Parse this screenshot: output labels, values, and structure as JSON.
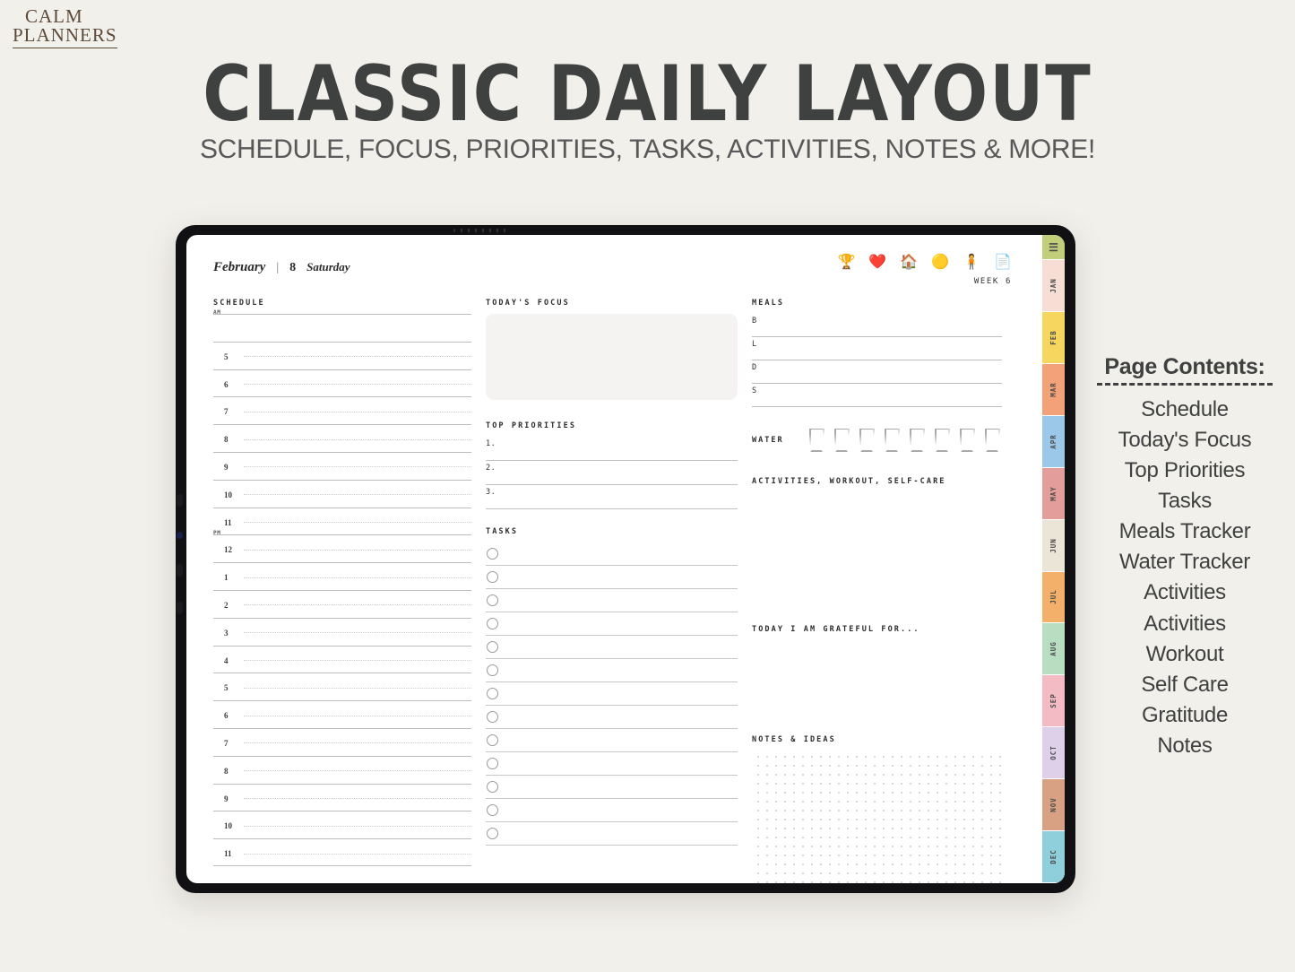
{
  "brand": {
    "line1": "CALM",
    "line2": "PLANNERS"
  },
  "header": {
    "title": "CLASSIC DAILY LAYOUT",
    "subtitle": "SCHEDULE, FOCUS, PRIORITIES, TASKS, ACTIVITIES, NOTES & MORE!"
  },
  "planner": {
    "date": {
      "month": "February",
      "separator": "|",
      "day": "8",
      "weekday": "Saturday"
    },
    "week": "WEEK 6",
    "top_icons": [
      {
        "name": "trophy-icon",
        "glyph": "🏆"
      },
      {
        "name": "heart-icon",
        "glyph": "❤️"
      },
      {
        "name": "house-icon",
        "glyph": "🏠"
      },
      {
        "name": "sun-circle-icon",
        "glyph": "🟡"
      },
      {
        "name": "person-icon",
        "glyph": "🧍"
      },
      {
        "name": "document-icon",
        "glyph": "📄"
      }
    ],
    "schedule": {
      "title": "SCHEDULE",
      "am_label": "AM",
      "pm_label": "PM",
      "rows": [
        {
          "hour": "",
          "marker": "AM"
        },
        {
          "hour": "5"
        },
        {
          "hour": "6"
        },
        {
          "hour": "7"
        },
        {
          "hour": "8"
        },
        {
          "hour": "9"
        },
        {
          "hour": "10"
        },
        {
          "hour": "11"
        },
        {
          "hour": "12",
          "marker": "PM"
        },
        {
          "hour": "1"
        },
        {
          "hour": "2"
        },
        {
          "hour": "3"
        },
        {
          "hour": "4"
        },
        {
          "hour": "5"
        },
        {
          "hour": "6"
        },
        {
          "hour": "7"
        },
        {
          "hour": "8"
        },
        {
          "hour": "9"
        },
        {
          "hour": "10"
        },
        {
          "hour": "11"
        }
      ]
    },
    "focus": {
      "title": "TODAY'S FOCUS",
      "value": ""
    },
    "priorities": {
      "title": "TOP PRIORITIES",
      "items": [
        {
          "label": "1.",
          "value": ""
        },
        {
          "label": "2.",
          "value": ""
        },
        {
          "label": "3.",
          "value": ""
        }
      ]
    },
    "tasks": {
      "title": "TASKS",
      "items": [
        "",
        "",
        "",
        "",
        "",
        "",
        "",
        "",
        "",
        "",
        "",
        "",
        ""
      ]
    },
    "meals": {
      "title": "MEALS",
      "rows": [
        {
          "label": "B",
          "value": ""
        },
        {
          "label": "L",
          "value": ""
        },
        {
          "label": "D",
          "value": ""
        },
        {
          "label": "S",
          "value": ""
        }
      ]
    },
    "water": {
      "label": "WATER",
      "glasses": 8,
      "filled": 0
    },
    "activities": {
      "title": "ACTIVITIES, WORKOUT, SELF-CARE",
      "value": ""
    },
    "gratitude": {
      "title": "TODAY I AM GRATEFUL FOR...",
      "value": ""
    },
    "notes": {
      "title": "NOTES & IDEAS",
      "value": ""
    },
    "rail": {
      "menu_icon": "☰",
      "menu_color": "#c2ce79",
      "months": [
        {
          "label": "JAN",
          "color": "#f7ded4"
        },
        {
          "label": "FEB",
          "color": "#f5d65e"
        },
        {
          "label": "MAR",
          "color": "#f2a179"
        },
        {
          "label": "APR",
          "color": "#9bc7e8"
        },
        {
          "label": "MAY",
          "color": "#e39e9b"
        },
        {
          "label": "JUN",
          "color": "#ebe5d8"
        },
        {
          "label": "JUL",
          "color": "#f3b06a"
        },
        {
          "label": "AUG",
          "color": "#b9ddc0"
        },
        {
          "label": "SEP",
          "color": "#f3bcc4"
        },
        {
          "label": "OCT",
          "color": "#ddd0e8"
        },
        {
          "label": "NOV",
          "color": "#d9a183"
        },
        {
          "label": "DEC",
          "color": "#8fcfdb"
        }
      ]
    }
  },
  "contents": {
    "title": "Page Contents:",
    "items": [
      "Schedule",
      "Today's Focus",
      "Top Priorities",
      "Tasks",
      "Meals Tracker",
      "Water Tracker",
      "Activities",
      "Activities",
      "Workout",
      "Self Care",
      "Gratitude",
      "Notes"
    ]
  }
}
